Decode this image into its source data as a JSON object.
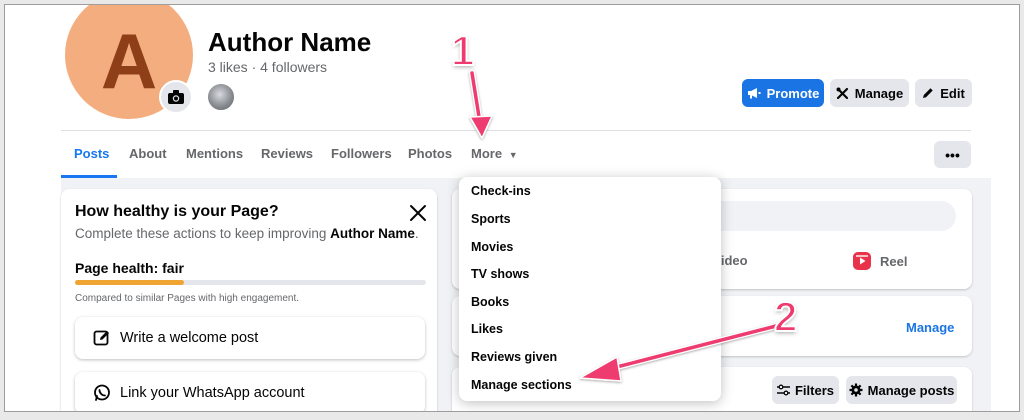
{
  "profile": {
    "avatar_letter": "A",
    "name": "Author Name",
    "stats": "3 likes · 4 followers"
  },
  "header_buttons": {
    "promote": "Promote",
    "manage": "Manage",
    "edit": "Edit",
    "more_options": "•••"
  },
  "tabs": [
    {
      "label": "Posts",
      "active": true
    },
    {
      "label": "About"
    },
    {
      "label": "Mentions"
    },
    {
      "label": "Reviews"
    },
    {
      "label": "Followers"
    },
    {
      "label": "Photos"
    },
    {
      "label": "More"
    }
  ],
  "more_menu": {
    "items": [
      "Check-ins",
      "Sports",
      "Movies",
      "TV shows",
      "Books",
      "Likes",
      "Reviews given",
      "Manage sections"
    ]
  },
  "health_card": {
    "title": "How healthy is your Page?",
    "subtitle_prefix": "Complete these actions to keep improving ",
    "subtitle_name": "Author Name",
    "subtitle_suffix": ".",
    "health_label": "Page health: fair",
    "health_progress_percent": 31,
    "comparison_note": "Compared to similar Pages with high engagement.",
    "actions": [
      "Write a welcome post",
      "Link your WhatsApp account"
    ]
  },
  "composer": {
    "photo_video_partial": "/video",
    "reel": "Reel"
  },
  "manage_card": {
    "link": "Manage"
  },
  "posts_toolbar": {
    "filters": "Filters",
    "manage_posts": "Manage posts"
  },
  "annotations": {
    "step1": "1",
    "step2": "2"
  },
  "colors": {
    "primary": "#1b74e4",
    "active_tab": "#1877f2",
    "annotation": "#ee3a6f",
    "health_bar": "#f0a533",
    "avatar_bg": "#f4ad7e"
  }
}
